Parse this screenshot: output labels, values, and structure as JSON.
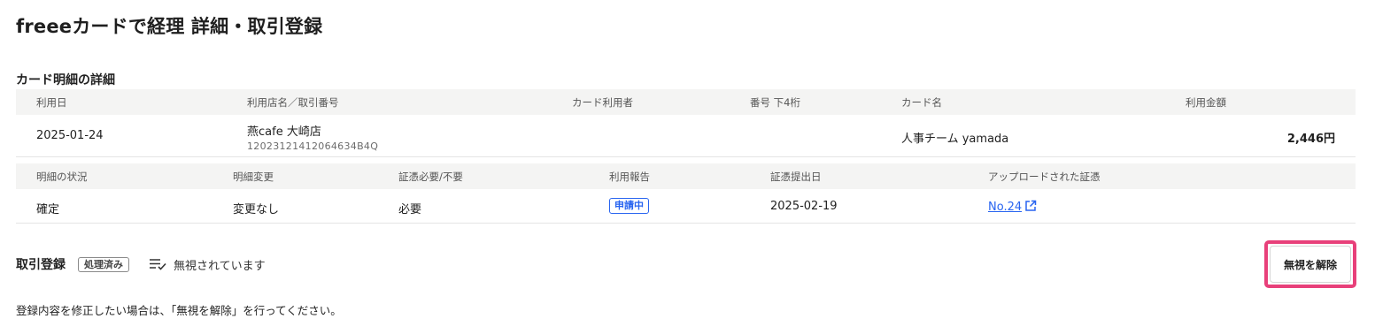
{
  "page": {
    "title": "freeeカードで経理 詳細・取引登録"
  },
  "card_detail": {
    "section_title": "カード明細の詳細",
    "headers": {
      "date": "利用日",
      "merchant": "利用店名／取引番号",
      "card_user": "カード利用者",
      "last4": "番号 下4桁",
      "card_name": "カード名",
      "amount": "利用金額"
    },
    "row": {
      "date": "2025-01-24",
      "merchant_name": "燕cafe 大崎店",
      "transaction_no": "12023121412064634B4Q",
      "card_user": "",
      "last4": "",
      "card_name": "人事チーム yamada",
      "amount": "2,446円"
    },
    "status_headers": {
      "status": "明細の状況",
      "change": "明細変更",
      "receipt_required": "証憑必要/不要",
      "usage_report": "利用報告",
      "receipt_date": "証憑提出日",
      "uploaded_receipt": "アップロードされた証憑"
    },
    "status_row": {
      "status": "確定",
      "change": "変更なし",
      "receipt_required": "必要",
      "usage_report": "申請中",
      "receipt_date": "2025-02-19",
      "uploaded_receipt": "No.24"
    }
  },
  "registration": {
    "title": "取引登録",
    "badge": "処理済み",
    "status_icon": "ignore-list-icon",
    "status_text": "無視されています",
    "unignore_button": "無視を解除",
    "note": "登録内容を修正したい場合は、「無視を解除」を行ってください。"
  },
  "colors": {
    "link": "#2864f0",
    "highlight": "#e8407a",
    "header_bg": "#f4f4f3"
  }
}
